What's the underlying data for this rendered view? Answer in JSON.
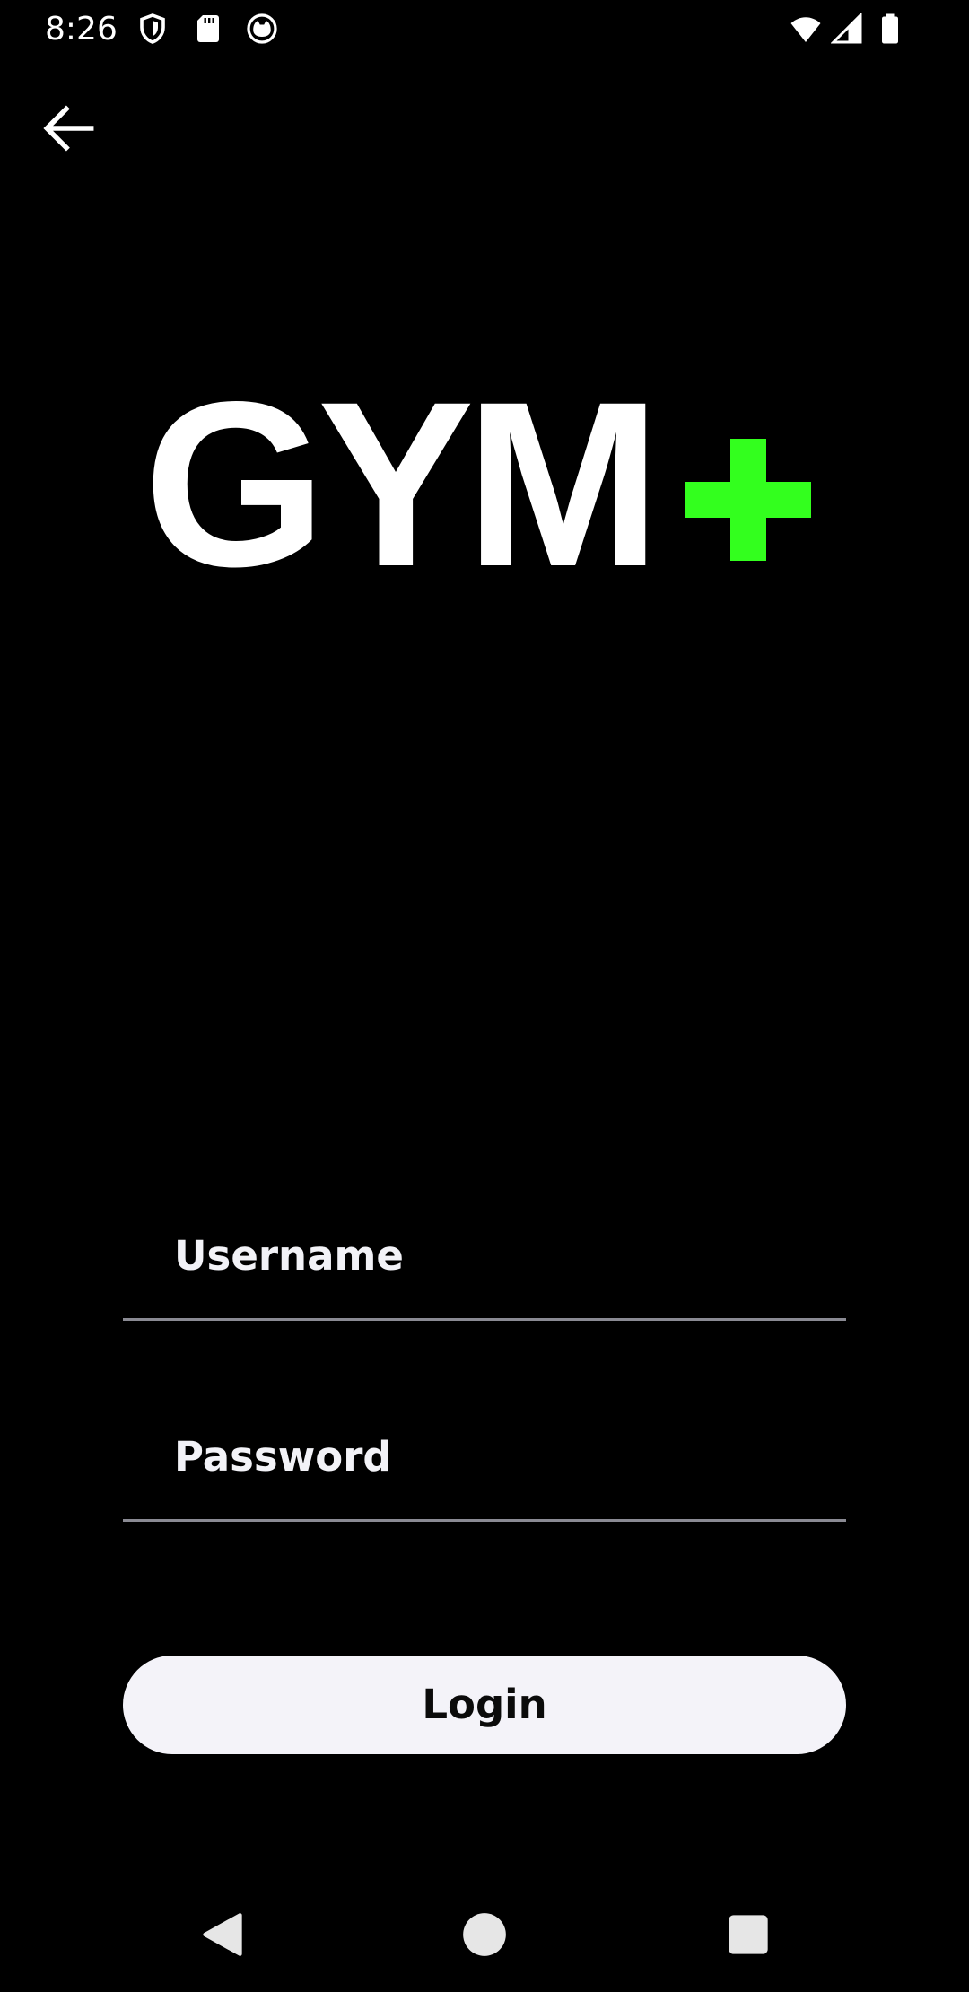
{
  "status_bar": {
    "time": "8:26",
    "left_icons": [
      "shield-icon",
      "sd-card-icon",
      "cat-face-icon"
    ],
    "right_icons": [
      "wifi-icon",
      "signal-icon",
      "battery-icon"
    ]
  },
  "app_bar": {
    "back_icon": "arrow-back-icon"
  },
  "logo": {
    "word": "GYM",
    "accent_symbol": "+",
    "accent_color": "#33ff1e"
  },
  "form": {
    "username_label": "Username",
    "password_label": "Password",
    "login_label": "Login"
  },
  "nav_bar": {
    "icons": [
      "nav-back-icon",
      "nav-home-icon",
      "nav-recents-icon"
    ]
  },
  "colors": {
    "background": "#000000",
    "text": "#ffffff",
    "button_bg": "#f4f3f9",
    "button_text": "#0b0b0b",
    "underline": "#8a8a93"
  }
}
